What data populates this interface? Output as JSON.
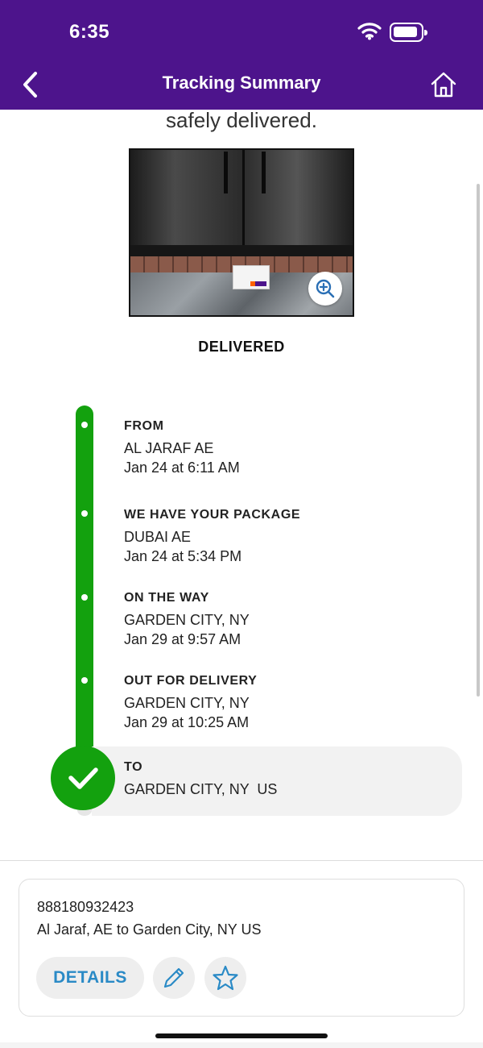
{
  "status_bar": {
    "time": "6:35"
  },
  "nav": {
    "title": "Tracking Summary",
    "back_icon": "chevron-left-icon",
    "home_icon": "home-icon",
    "bar_color": "#4d148c"
  },
  "delivery": {
    "message": "safely delivered.",
    "status": "DELIVERED",
    "photo_zoom_icon": "zoom-in-icon"
  },
  "timeline": {
    "accent_color": "#13a10e",
    "events": [
      {
        "heading": "FROM",
        "location": "AL JARAF AE",
        "time": "Jan 24 at 6:11 AM"
      },
      {
        "heading": "WE HAVE YOUR PACKAGE",
        "location": "DUBAI AE",
        "time": "Jan 24 at 5:34 PM"
      },
      {
        "heading": "ON THE WAY",
        "location": "GARDEN CITY, NY",
        "time": "Jan 29 at 9:57 AM"
      },
      {
        "heading": "OUT FOR DELIVERY",
        "location": "GARDEN CITY, NY",
        "time": "Jan 29 at 10:25 AM"
      },
      {
        "heading": "TO",
        "location": "GARDEN CITY, NY  US"
      }
    ]
  },
  "shipment": {
    "tracking_number": "888180932423",
    "route": "Al Jaraf, AE to Garden City, NY US",
    "details_label": "DETAILS",
    "edit_icon": "pencil-icon",
    "favorite_icon": "star-icon",
    "link_color": "#2a8ac6"
  }
}
